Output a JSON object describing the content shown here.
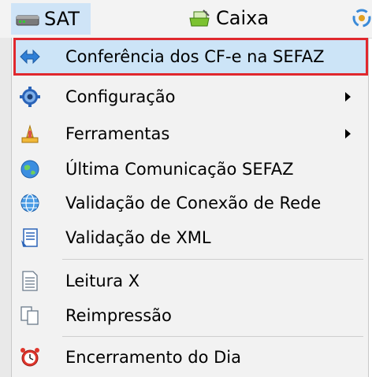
{
  "menubar": {
    "sat_label": "SAT",
    "caixa_label": "Caixa"
  },
  "dropdown": {
    "items": [
      {
        "label": "Conferência dos CF-e na SEFAZ",
        "icon": "arrows-exchange-icon"
      },
      {
        "label": "Configuração",
        "icon": "gear-icon",
        "submenu": true
      },
      {
        "label": "Ferramentas",
        "icon": "tools-icon",
        "submenu": true
      },
      {
        "label": "Última Comunicação SEFAZ",
        "icon": "globe-icon"
      },
      {
        "label": "Validação de Conexão de Rede",
        "icon": "network-globe-icon"
      },
      {
        "label": "Validação de XML",
        "icon": "xml-document-icon"
      },
      {
        "label": "Leitura X",
        "icon": "document-icon"
      },
      {
        "label": "Reimpressão",
        "icon": "copy-document-icon"
      },
      {
        "label": "Encerramento do Dia",
        "icon": "alarm-clock-icon"
      }
    ]
  },
  "colors": {
    "highlight_bg": "#cce4f7",
    "highlight_border": "#e0282e",
    "menu_bg": "#f2f2f2"
  }
}
